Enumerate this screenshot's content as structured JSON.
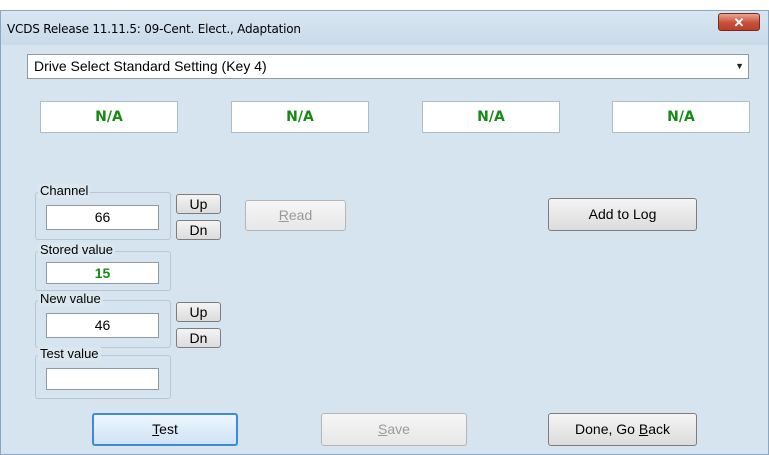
{
  "window": {
    "title": "VCDS Release 11.11.5: 09-Cent. Elect.,  Adaptation",
    "close_glyph": "✕"
  },
  "dropdown": {
    "value": "Drive Select Standard Setting (Key 4)",
    "arrow_glyph": "▼"
  },
  "na_boxes": [
    "N/A",
    "N/A",
    "N/A",
    "N/A"
  ],
  "channel": {
    "label": "Channel",
    "value": "66",
    "up": "Up",
    "dn": "Dn"
  },
  "stored_value": {
    "label": "Stored value",
    "value": "15"
  },
  "new_value": {
    "label": "New value",
    "value": "46",
    "up": "Up",
    "dn": "Dn"
  },
  "test_value": {
    "label": "Test value",
    "value": ""
  },
  "buttons": {
    "read": {
      "pre": "",
      "u": "R",
      "post": "ead"
    },
    "add_to_log": "Add to Log",
    "test": {
      "pre": "",
      "u": "T",
      "post": "est"
    },
    "save": {
      "pre": "",
      "u": "S",
      "post": "ave"
    },
    "done": {
      "pre": "Done, Go ",
      "u": "B",
      "post": "ack"
    }
  },
  "colors": {
    "ok_text": "#158a15",
    "window_bg": "#d6e4ef",
    "focus_border": "#3d8ad7"
  }
}
